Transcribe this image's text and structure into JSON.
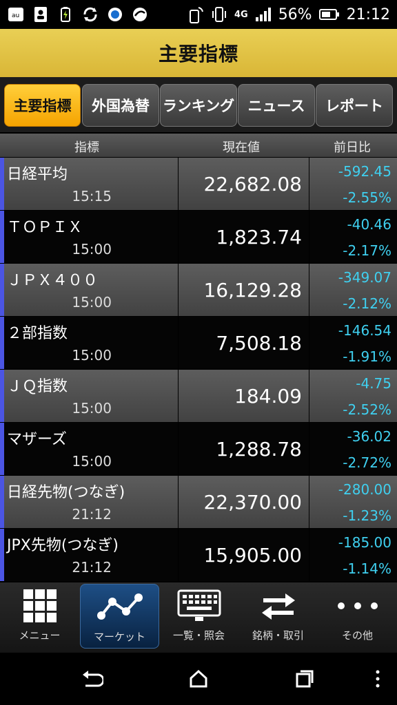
{
  "status_bar": {
    "battery_pct": "56%",
    "time": "21:12",
    "network": "4G"
  },
  "header": {
    "title": "主要指標"
  },
  "tabs": [
    {
      "label": "主要指標",
      "active": true
    },
    {
      "label": "外国為替",
      "active": false
    },
    {
      "label": "ランキング",
      "active": false
    },
    {
      "label": "ニュース",
      "active": false
    },
    {
      "label": "レポート",
      "active": false
    }
  ],
  "columns": {
    "name": "指標",
    "price": "現在値",
    "change": "前日比"
  },
  "rows": [
    {
      "name": "日経平均",
      "time": "15:15",
      "price": "22,682.08",
      "change": "-592.45",
      "pct": "-2.55%"
    },
    {
      "name": "ＴＯＰＩＸ",
      "time": "15:00",
      "price": "1,823.74",
      "change": "-40.46",
      "pct": "-2.17%"
    },
    {
      "name": "ＪＰＸ４００",
      "time": "15:00",
      "price": "16,129.28",
      "change": "-349.07",
      "pct": "-2.12%"
    },
    {
      "name": "２部指数",
      "time": "15:00",
      "price": "7,508.18",
      "change": "-146.54",
      "pct": "-1.91%"
    },
    {
      "name": "ＪＱ指数",
      "time": "15:00",
      "price": "184.09",
      "change": "-4.75",
      "pct": "-2.52%"
    },
    {
      "name": "マザーズ",
      "time": "15:00",
      "price": "1,288.78",
      "change": "-36.02",
      "pct": "-2.72%"
    },
    {
      "name": "日経先物(つなぎ)",
      "time": "21:12",
      "price": "22,370.00",
      "change": "-280.00",
      "pct": "-1.23%"
    },
    {
      "name": "JPX先物(つなぎ)",
      "time": "21:12",
      "price": "15,905.00",
      "change": "-185.00",
      "pct": "-1.14%"
    }
  ],
  "bottom_nav": [
    {
      "label": "メニュー",
      "icon": "grid-icon"
    },
    {
      "label": "マーケット",
      "icon": "chart-line-icon",
      "active": true
    },
    {
      "label": "一覧・照会",
      "icon": "keyboard-monitor-icon"
    },
    {
      "label": "銘柄・取引",
      "icon": "swap-arrows-icon"
    },
    {
      "label": "その他",
      "icon": "more-dots-icon"
    }
  ],
  "colors": {
    "header_gold": "#e0c246",
    "active_tab": "#f8b400",
    "accent_bar": "#4b55e3",
    "change_text": "#3fd0f0"
  }
}
